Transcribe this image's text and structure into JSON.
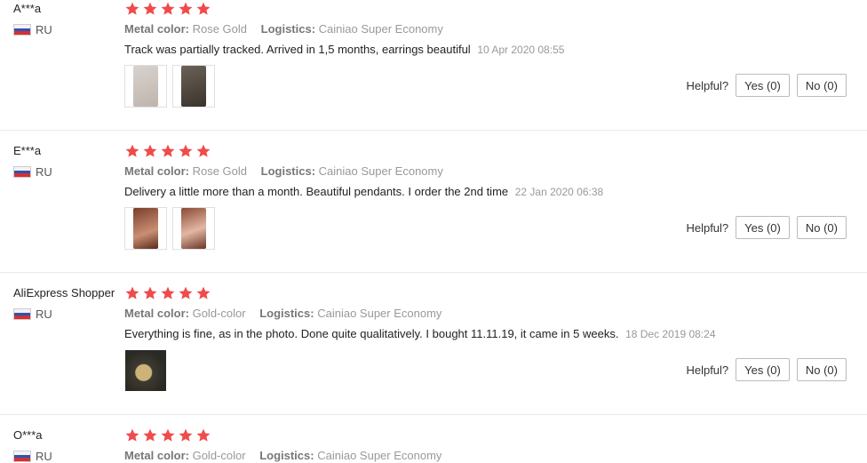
{
  "reviews": [
    {
      "user": "A***a",
      "country": "RU",
      "stars": 5,
      "attr1_key": "Metal color:",
      "attr1_val": "Rose Gold",
      "attr2_key": "Logistics:",
      "attr2_val": "Cainiao Super Economy",
      "text": "Track was partially tracked. Arrived in 1,5 months, earrings beautiful",
      "date": "10 Apr 2020 08:55",
      "photos": 2,
      "helpful_label": "Helpful?",
      "yes_label": "Yes (0)",
      "no_label": "No (0)"
    },
    {
      "user": "E***a",
      "country": "RU",
      "stars": 5,
      "attr1_key": "Metal color:",
      "attr1_val": "Rose Gold",
      "attr2_key": "Logistics:",
      "attr2_val": "Cainiao Super Economy",
      "text": "Delivery a little more than a month. Beautiful pendants. I order the 2nd time",
      "date": "22 Jan 2020 06:38",
      "photos": 2,
      "helpful_label": "Helpful?",
      "yes_label": "Yes (0)",
      "no_label": "No (0)"
    },
    {
      "user": "AliExpress Shopper",
      "country": "RU",
      "stars": 5,
      "attr1_key": "Metal color:",
      "attr1_val": "Gold-color",
      "attr2_key": "Logistics:",
      "attr2_val": "Cainiao Super Economy",
      "text": "Everything is fine, as in the photo. Done quite qualitatively. I bought 11.11.19, it came in 5 weeks.",
      "date": "18 Dec 2019 08:24",
      "photos": 1,
      "helpful_label": "Helpful?",
      "yes_label": "Yes (0)",
      "no_label": "No (0)"
    },
    {
      "user": "O***a",
      "country": "RU",
      "stars": 5,
      "attr1_key": "Metal color:",
      "attr1_val": "Gold-color",
      "attr2_key": "Logistics:",
      "attr2_val": "Cainiao Super Economy"
    }
  ],
  "colors": {
    "star": "#f04b4b",
    "divider": "#e8e8e8"
  },
  "icons": {
    "star": "star-icon",
    "flag": "flag-ru-icon"
  }
}
